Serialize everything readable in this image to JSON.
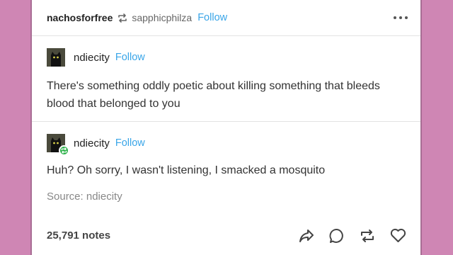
{
  "header": {
    "poster": "nachosforfree",
    "reblogged_from": "sapphicphilza",
    "follow_label": "Follow",
    "more_icon": "ellipsis-icon"
  },
  "posts": [
    {
      "blog": "ndiecity",
      "follow_label": "Follow",
      "text": "There's something oddly poetic about killing something that bleeds blood that belonged to you"
    },
    {
      "blog": "ndiecity",
      "follow_label": "Follow",
      "text": "Huh? Oh sorry, I wasn't listening, I smacked a mosquito",
      "source": "Source: ndiecity"
    }
  ],
  "footer": {
    "notes": "25,791 notes",
    "actions": [
      "share-icon",
      "reply-icon",
      "reblog-icon",
      "like-icon"
    ]
  },
  "colors": {
    "background": "#cf86b4",
    "follow": "#39a5e8",
    "badge": "#2fb24c"
  }
}
